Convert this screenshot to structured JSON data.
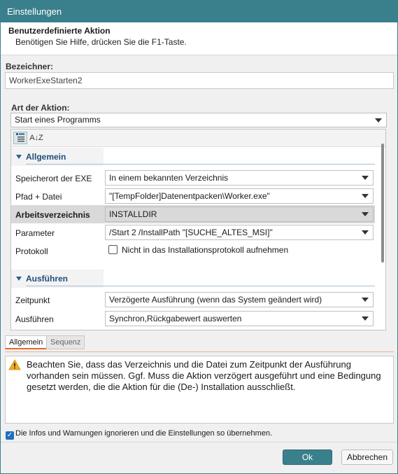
{
  "window": {
    "title": "Einstellungen"
  },
  "header": {
    "title": "Benutzerdefinierte Aktion",
    "subtitle": "Benötigen Sie Hilfe, drücken Sie die F1-Taste."
  },
  "identifier": {
    "label": "Bezeichner:",
    "value": "WorkerExeStarten2"
  },
  "action_type": {
    "label": "Art der Aktion:",
    "value": "Start eines Programms"
  },
  "toolbar": {
    "categorized_icon": "categorized-icon",
    "sort_icon": "sort-az-icon",
    "sort_glyph": "A↓Z"
  },
  "sections": {
    "general": {
      "title": "Allgemein",
      "rows": [
        {
          "name": "Speicherort der EXE",
          "value": "In einem bekannten Verzeichnis"
        },
        {
          "name": "Pfad + Datei",
          "value": "\"[TempFolder]Datenentpacken\\Worker.exe\""
        },
        {
          "name": "Arbeitsverzeichnis",
          "value": "INSTALLDIR"
        },
        {
          "name": "Parameter",
          "value": "/Start 2 /InstallPath \"[SUCHE_ALTES_MSI]\""
        },
        {
          "name": "Protokoll",
          "checkbox_label": "Nicht in das Installationsprotokoll aufnehmen",
          "checked": false
        }
      ]
    },
    "execute": {
      "title": "Ausführen",
      "rows": [
        {
          "name": "Zeitpunkt",
          "value": "Verzögerte Ausführung (wenn das System geändert wird)"
        },
        {
          "name": "Ausführen",
          "value": "Synchron,Rückgabewert auswerten"
        }
      ]
    }
  },
  "tabs": [
    {
      "label": "Allgemein",
      "active": true
    },
    {
      "label": "Sequenz",
      "active": false
    }
  ],
  "message": {
    "icon": "warning-icon",
    "text": "Beachten Sie, dass das Verzeichnis und die Datei zum Zeitpunkt der Ausführung vorhanden sein müssen. Ggf. Muss die Aktion verzögert ausgeführt und eine Bedingung gesetzt werden, die die Aktion für die (De-) Installation ausschließt."
  },
  "ignore_warnings": {
    "label": "Die Infos und Warnungen ignorieren und die Einstellungen so übernehmen.",
    "checked": true,
    "check_glyph": "✓"
  },
  "buttons": {
    "ok": "Ok",
    "cancel": "Abbrechen"
  },
  "colors": {
    "accent": "#3a7f8c",
    "section_title": "#1f4e79",
    "tab_underline": "#e06d2f",
    "warning": "#f2b01e"
  }
}
